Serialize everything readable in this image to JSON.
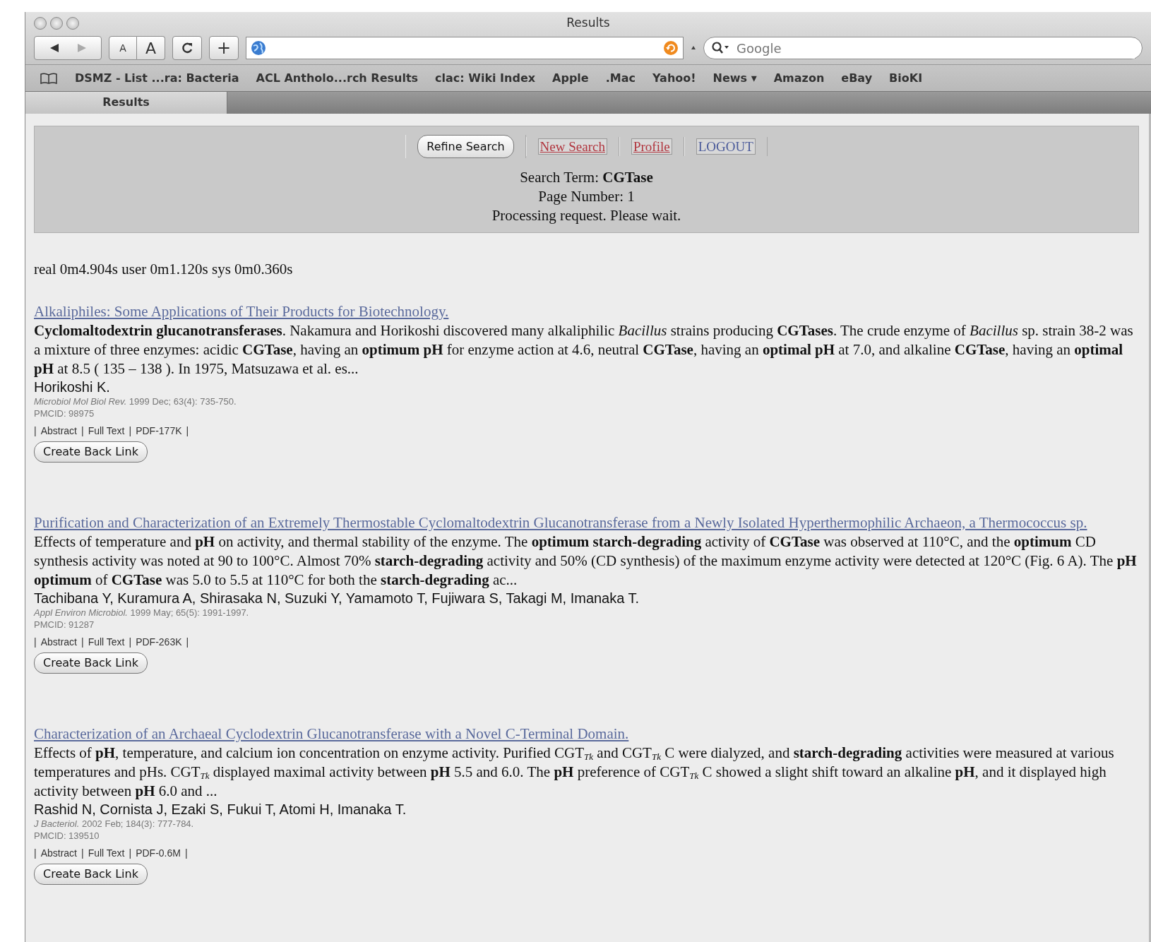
{
  "window": {
    "title": "Results"
  },
  "toolbar": {
    "text_smaller": "A",
    "text_bigger": "A",
    "add": "+",
    "search_placeholder": "Google"
  },
  "bookmarks": [
    "DSMZ - List ...ra: Bacteria",
    "ACL Antholo...rch Results",
    "clac: Wiki Index",
    "Apple",
    ".Mac",
    "Yahoo!",
    "News ▾",
    "Amazon",
    "eBay",
    "BioKI"
  ],
  "tabs": [
    {
      "label": "Results",
      "selected": true
    }
  ],
  "nav_buttons": [
    {
      "label": "Refine Search",
      "kind": "button"
    },
    {
      "label": "New Search",
      "kind": "link"
    },
    {
      "label": "Profile",
      "kind": "link"
    },
    {
      "label": "LOGOUT",
      "kind": "plain"
    }
  ],
  "search_info": [
    "Search Term: **CGTase**",
    "Page Number: 1",
    "Processing request. Please wait."
  ],
  "timing": "real 0m4.904s user 0m1.120s sys 0m0.360s",
  "link_separator": "|",
  "results": [
    {
      "title": "Alkaliphiles: Some Applications of Their Products for Biotechnology.",
      "abstract": "**Cyclomaltodextrin glucanotransferases**. Nakamura and Horikoshi discovered many alkaliphilic *Bacillus* strains producing **CGTases**. The crude enzyme of *Bacillus* sp. strain 38-2 was a mixture of three enzymes: acidic **CGTase**, having an **optimum pH** for enzyme action at 4.6, neutral **CGTase**, having an **optimal pH** at 7.0, and alkaline **CGTase**, having an **optimal pH** at 8.5 ( 135 – 138 ). In 1975, Matsuzawa et al. es...",
      "authors": "Horikoshi K.",
      "citation": "*Microbiol Mol Biol Rev.* 1999 Dec; 63(4): 735-750.",
      "pmcid": "PMCID: 98975",
      "links": [
        "Abstract",
        "Full Text",
        "PDF-177K"
      ],
      "button": "Create Back Link"
    },
    {
      "title": "Purification and Characterization of an Extremely Thermostable Cyclomaltodextrin Glucanotransferase from a Newly Isolated Hyperthermophilic Archaeon, a Thermococcus sp.",
      "abstract": "Effects of temperature and **pH** on activity, and thermal stability of the enzyme. The **optimum starch-degrading** activity of **CGTase** was observed at 110°C, and the **optimum** CD synthesis activity was noted at 90 to 100°C. Almost 70% **starch-degrading** activity and 50% (CD synthesis) of the maximum enzyme activity were detected at 120°C (Fig. 6 A). The **pH optimum** of **CGTase** was 5.0 to 5.5 at 110°C for both the **starch-degrading** ac...",
      "authors": "Tachibana Y, Kuramura A, Shirasaka N, Suzuki Y, Yamamoto T, Fujiwara S, Takagi M, Imanaka T.",
      "citation": "*Appl Environ Microbiol.* 1999 May; 65(5): 1991-1997.",
      "pmcid": "PMCID: 91287",
      "links": [
        "Abstract",
        "Full Text",
        "PDF-263K"
      ],
      "button": "Create Back Link"
    },
    {
      "title": "Characterization of an Archaeal Cyclodextrin Glucanotransferase with a Novel C-Terminal Domain.",
      "abstract": "Effects of **pH**, temperature, and calcium ion concentration on enzyme activity. Purified CGT$_{Tk}$ and CGT$_{Tk}$ C were dialyzed, and **starch-degrading** activities were measured at various temperatures and pHs. CGT$_{Tk}$ displayed maximal activity between **pH** 5.5 and 6.0. The **pH** preference of CGT$_{Tk}$ C showed a slight shift toward an alkaline **pH**, and it displayed high activity between **pH** 6.0 and ...",
      "authors": "Rashid N, Cornista J, Ezaki S, Fukui T, Atomi H, Imanaka T.",
      "citation": "*J Bacteriol.* 2002 Feb; 184(3): 777-784.",
      "pmcid": "PMCID: 139510",
      "links": [
        "Abstract",
        "Full Text",
        "PDF-0.6M"
      ],
      "button": "Create Back Link"
    }
  ]
}
